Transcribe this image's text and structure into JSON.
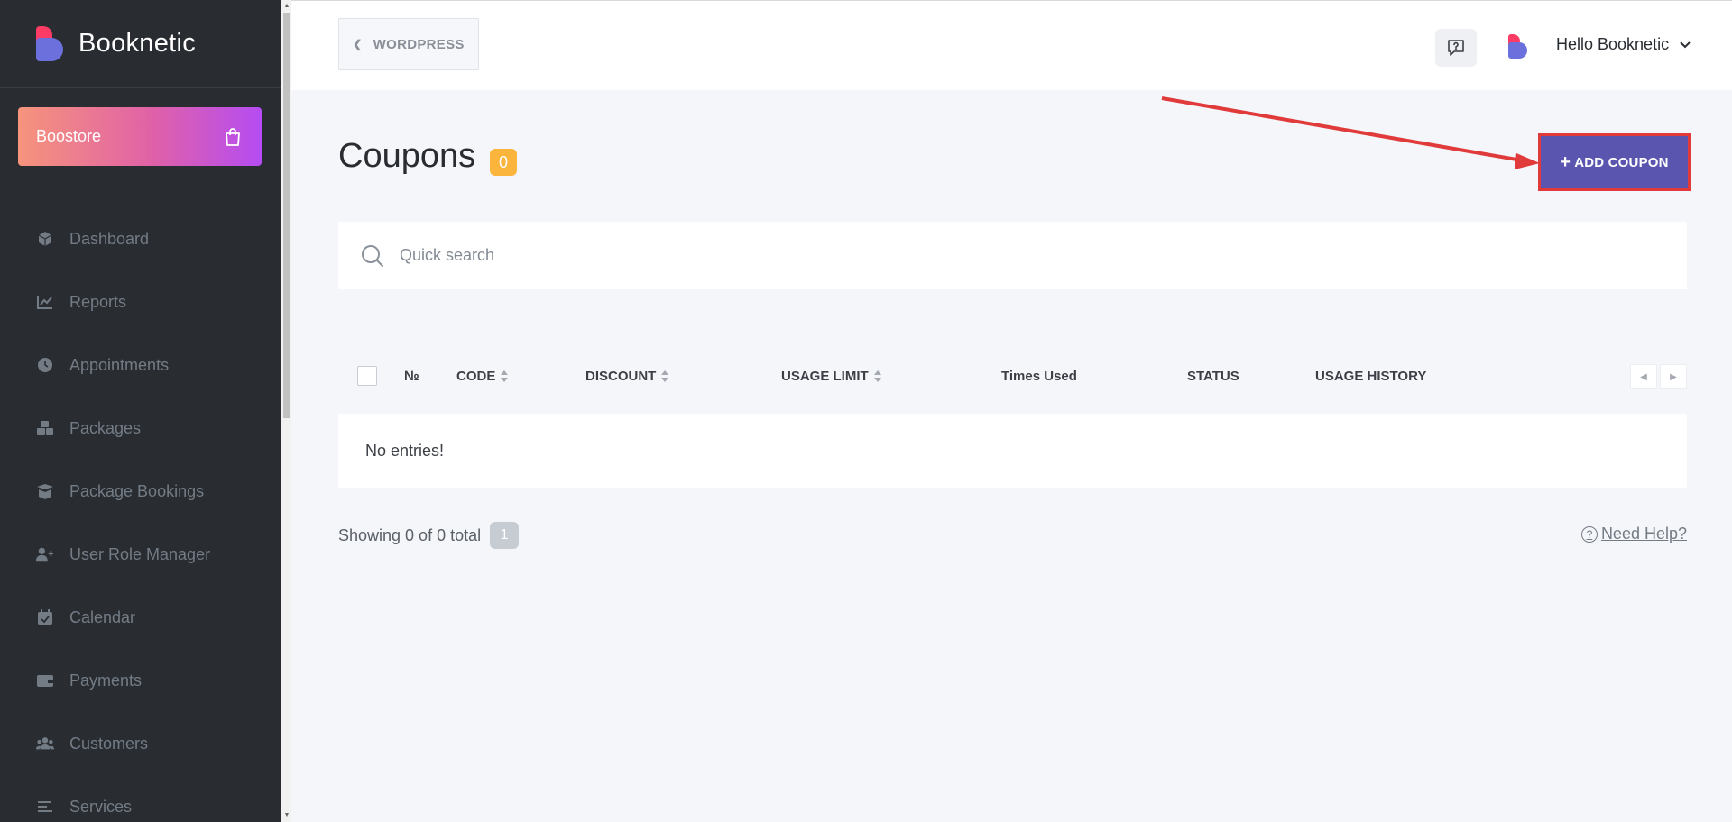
{
  "brand": {
    "name": "Booknetic"
  },
  "boostore": {
    "label": "Boostore",
    "icon": "shopping-bag-icon"
  },
  "sidebar": {
    "items": [
      {
        "label": "Dashboard",
        "icon": "cube-icon"
      },
      {
        "label": "Reports",
        "icon": "chart-line-icon"
      },
      {
        "label": "Appointments",
        "icon": "clock-icon"
      },
      {
        "label": "Packages",
        "icon": "boxes-icon"
      },
      {
        "label": "Package Bookings",
        "icon": "box-open-icon"
      },
      {
        "label": "User Role Manager",
        "icon": "user-plus-icon"
      },
      {
        "label": "Calendar",
        "icon": "calendar-check-icon"
      },
      {
        "label": "Payments",
        "icon": "wallet-icon"
      },
      {
        "label": "Customers",
        "icon": "users-icon"
      },
      {
        "label": "Services",
        "icon": "list-icon"
      }
    ]
  },
  "topbar": {
    "back_label": "WORDPRESS",
    "user_greeting": "Hello Booknetic"
  },
  "page": {
    "title": "Coupons",
    "count": "0",
    "add_button": "ADD COUPON"
  },
  "search": {
    "placeholder": "Quick search"
  },
  "table": {
    "columns": {
      "num": "№",
      "code": "CODE",
      "discount": "DISCOUNT",
      "usage_limit": "USAGE LIMIT",
      "times_used": "Times Used",
      "status": "STATUS",
      "usage_history": "USAGE HISTORY"
    },
    "empty_text": "No entries!"
  },
  "footer": {
    "showing": "Showing 0 of 0 total",
    "page": "1",
    "help": "Need Help?"
  },
  "colors": {
    "sidebar_bg": "#292d32",
    "accent": "#5a56b0",
    "badge": "#fbb43c",
    "annotation": "#e03a3a"
  }
}
